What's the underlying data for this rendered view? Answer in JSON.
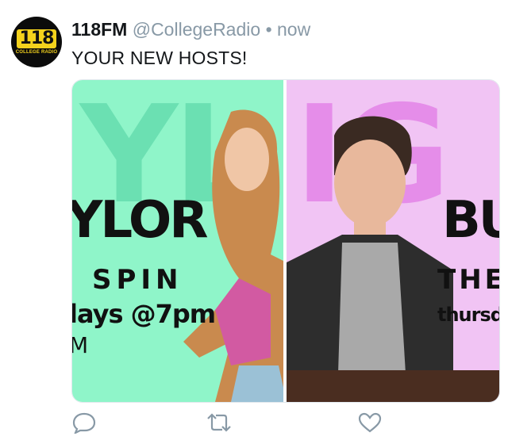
{
  "tweet": {
    "avatar": {
      "number": "118",
      "subtitle": "COLLEGE RADIO"
    },
    "display_name": "118FM",
    "handle": "@CollegeRadio",
    "separator": "•",
    "time": "now",
    "text": "YOUR NEW HOSTS!"
  },
  "media": {
    "left": {
      "line1": "YLOR",
      "line2": "SPIN",
      "line3": "lays @7pm",
      "line4": "M"
    },
    "right": {
      "line1": "BU",
      "line2": "THE",
      "line3": "thursd"
    }
  },
  "colors": {
    "left_bg": "#8ff5c9",
    "right_bg": "#f1c4f4",
    "icon": "#8899a6"
  },
  "icons": [
    "reply-icon",
    "retweet-icon",
    "like-icon"
  ]
}
